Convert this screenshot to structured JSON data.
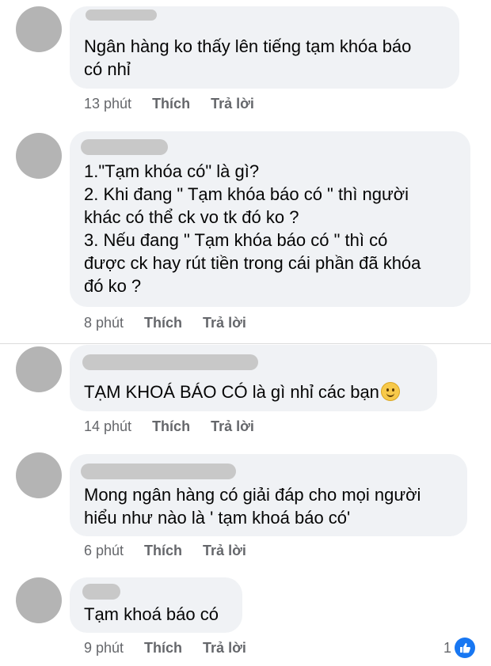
{
  "comments": [
    {
      "text": "Ngân hàng ko thấy lên tiếng tạm khóa báo\ncó nhỉ",
      "time": "13 phút",
      "like": "Thích",
      "reply": "Trả lời"
    },
    {
      "text": "1.\"Tạm khóa có\" là gì?\n2. Khi đang \" Tạm khóa báo có \" thì người\nkhác có thể ck vo tk đó ko ?\n3. Nếu đang \" Tạm khóa báo có \" thì có\nđược ck hay rút tiền trong cái phần đã khóa\nđó ko ?",
      "time": "8 phút",
      "like": "Thích",
      "reply": "Trả lời"
    },
    {
      "text": "TẠM KHOÁ BÁO CÓ là gì nhỉ các bạn",
      "time": "14 phút",
      "like": "Thích",
      "reply": "Trả lời"
    },
    {
      "text": "Mong ngân hàng có giải đáp cho mọi người\nhiểu như nào là ' tạm khoá báo có'",
      "time": "6 phút",
      "like": "Thích",
      "reply": "Trả lời"
    },
    {
      "text": "Tạm khoá báo có",
      "time": "9 phút",
      "like": "Thích",
      "reply": "Trả lời",
      "reaction_count": "1"
    }
  ],
  "icons": {
    "emoji": "slightly-smiling-face-icon",
    "reaction": "like-thumb-icon"
  },
  "colors": {
    "bubble": "#f0f2f5",
    "meta": "#65676b",
    "like_blue": "#1877f2"
  }
}
